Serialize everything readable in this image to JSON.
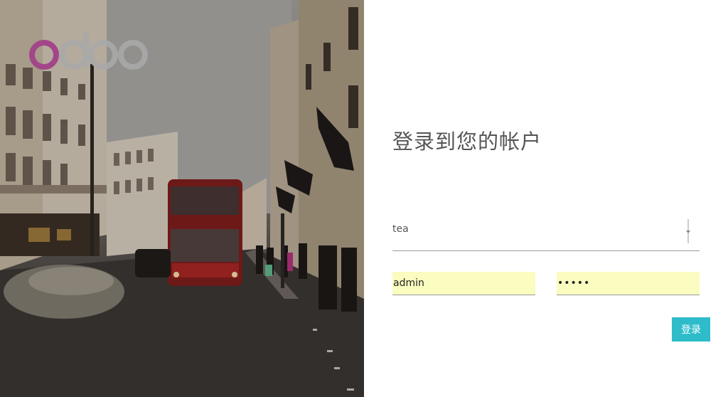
{
  "hero": {
    "alt_description": ""
  },
  "logo": {
    "text": "odoo",
    "accent_color": "#a24689",
    "gray_color": "#a9a9a9"
  },
  "login": {
    "title": "登录到您的帐户",
    "database_value": "tea",
    "login_value": "admin",
    "password_value": "•••••",
    "submit_label": "登录"
  },
  "colors": {
    "button": "#2ebccb",
    "autofill": "#fafcc0",
    "title": "#555555"
  }
}
